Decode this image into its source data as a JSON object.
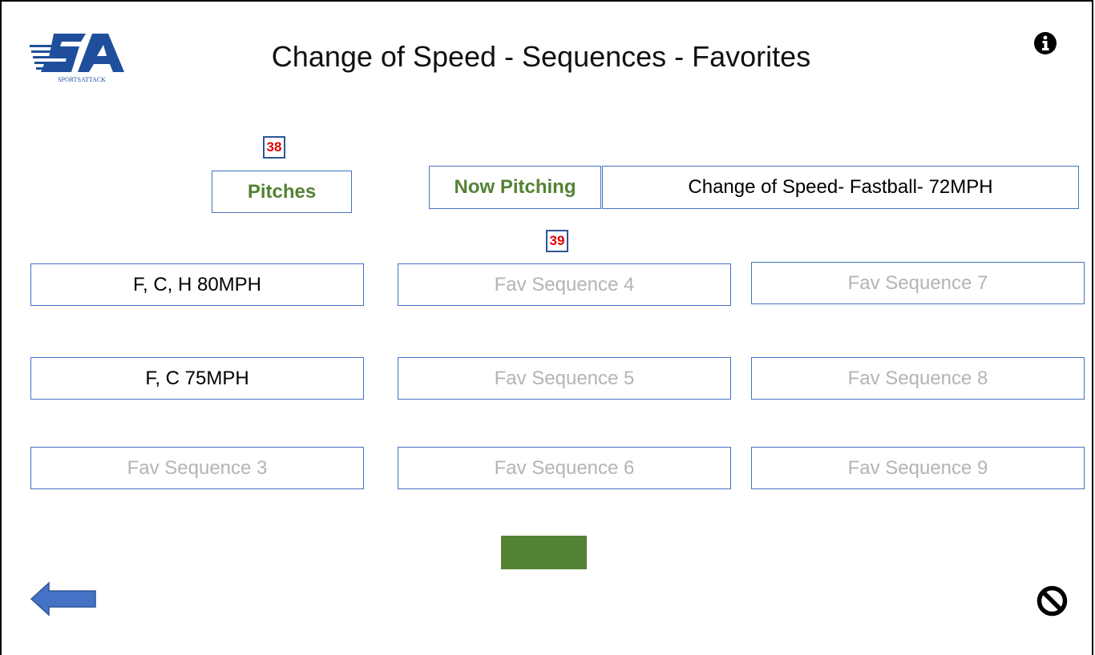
{
  "header": {
    "logo_text": "SPORTSATTACK",
    "title": "Change of Speed - Sequences - Favorites",
    "info_icon": "info-icon"
  },
  "badges": {
    "pitches_badge": "38",
    "sequence_badge": "39"
  },
  "pitches_button": {
    "label": "Pitches"
  },
  "now_pitching": {
    "label": "Now Pitching",
    "value": "Change of Speed- Fastball- 72MPH"
  },
  "sequences": [
    {
      "label": "F, C, H 80MPH",
      "state": "saved"
    },
    {
      "label": "F, C 75MPH",
      "state": "saved"
    },
    {
      "label": "Fav Sequence 3",
      "state": "empty"
    },
    {
      "label": "Fav Sequence 4",
      "state": "empty"
    },
    {
      "label": "Fav Sequence 5",
      "state": "empty"
    },
    {
      "label": "Fav Sequence 6",
      "state": "empty"
    },
    {
      "label": "Fav Sequence 7",
      "state": "empty"
    },
    {
      "label": "Fav Sequence 8",
      "state": "empty"
    },
    {
      "label": "Fav Sequence 9",
      "state": "empty"
    }
  ],
  "colors": {
    "accent_green": "#548235",
    "border_blue": "#4472c4",
    "badge_red": "#e00000",
    "arrow_blue": "#4472c4",
    "logo_blue": "#1f4e9c"
  },
  "footer": {
    "back_icon": "left-arrow-icon",
    "cancel_icon": "cancel-icon"
  }
}
